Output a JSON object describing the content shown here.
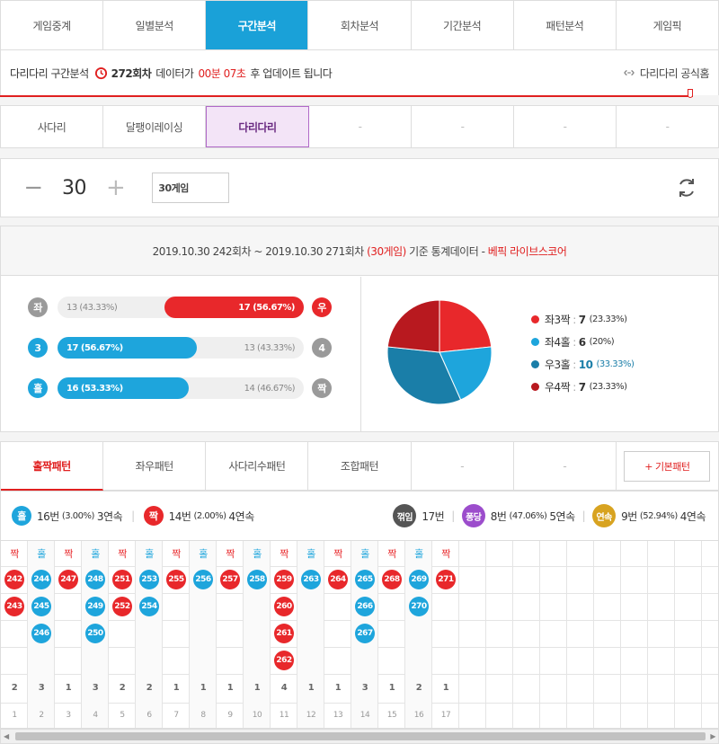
{
  "nav": {
    "tabs": [
      "게임중계",
      "일별분석",
      "구간분석",
      "회차분석",
      "기간분석",
      "패턴분석",
      "게임픽"
    ]
  },
  "info": {
    "game": "다리다리 구간분석",
    "round": "272회차",
    "mid": "데이터가",
    "time": "00분 07초",
    "tail": "후 업데이트 됩니다",
    "official": "다리다리 공식홈"
  },
  "subtabs": [
    "사다리",
    "달팽이레이싱",
    "다리다리",
    "-",
    "-",
    "-",
    "-"
  ],
  "control": {
    "minus": "−",
    "count": "30",
    "plus": "+",
    "games_value": "30게임"
  },
  "stats": {
    "period": "2019.10.30 242회차 ~ 2019.10.30 271회차",
    "games": "(30게임)",
    "basis": "기준 통계데이터 -",
    "brand": "베픽 라이브스코어",
    "rows": [
      {
        "left_icon": "좌",
        "right_icon": "우",
        "left_text": "13 (43.33%)",
        "right_text": "17 (56.67%)",
        "left_pct": 43.33,
        "winner": "right"
      },
      {
        "left_icon": "3",
        "right_icon": "4",
        "left_text": "17 (56.67%)",
        "right_text": "13 (43.33%)",
        "left_pct": 56.67,
        "winner": "left"
      },
      {
        "left_icon": "홀",
        "right_icon": "짝",
        "left_text": "16 (53.33%)",
        "right_text": "14 (46.67%)",
        "left_pct": 53.33,
        "winner": "left"
      }
    ],
    "pie": [
      {
        "label": "좌3짝",
        "count": "7",
        "pct": "(23.33%)",
        "value": 7,
        "color": "#e8282b"
      },
      {
        "label": "좌4홀",
        "count": "6",
        "pct": "(20%)",
        "value": 6,
        "color": "#1ea5dc"
      },
      {
        "label": "우3홀",
        "count": "10",
        "pct": "(33.33%)",
        "value": 10,
        "color": "#1a7ea8"
      },
      {
        "label": "우4짝",
        "count": "7",
        "pct": "(23.33%)",
        "value": 7,
        "color": "#b8191f"
      }
    ]
  },
  "pattern_tabs": [
    "홀짝패턴",
    "좌우패턴",
    "사다리수패턴",
    "조합패턴",
    "-",
    "-"
  ],
  "basic_pattern": "+ 기본패턴",
  "summary": {
    "odd_icon": "홀",
    "odd_count": "16번",
    "odd_pct": "(3.00%)",
    "odd_streak": "3연속",
    "even_icon": "짝",
    "even_count": "14번",
    "even_pct": "(2.00%)",
    "even_streak": "4연속",
    "bend_icon": "꺾임",
    "bend_count": "17번",
    "bounce_icon": "퐁당",
    "bounce_count": "8번",
    "bounce_pct": "(47.06%)",
    "bounce_streak": "5연속",
    "cont_icon": "연속",
    "cont_count": "9번",
    "cont_pct": "(52.94%)",
    "cont_streak": "4연속"
  },
  "columns": [
    {
      "head": "짝",
      "type": "even",
      "balls": [
        "242",
        "243"
      ],
      "count": "2",
      "index": "1"
    },
    {
      "head": "홀",
      "type": "odd",
      "balls": [
        "244",
        "245",
        "246"
      ],
      "count": "3",
      "index": "2"
    },
    {
      "head": "짝",
      "type": "even",
      "balls": [
        "247"
      ],
      "count": "1",
      "index": "3"
    },
    {
      "head": "홀",
      "type": "odd",
      "balls": [
        "248",
        "249",
        "250"
      ],
      "count": "3",
      "index": "4"
    },
    {
      "head": "짝",
      "type": "even",
      "balls": [
        "251",
        "252"
      ],
      "count": "2",
      "index": "5"
    },
    {
      "head": "홀",
      "type": "odd",
      "balls": [
        "253",
        "254"
      ],
      "count": "2",
      "index": "6"
    },
    {
      "head": "짝",
      "type": "even",
      "balls": [
        "255"
      ],
      "count": "1",
      "index": "7"
    },
    {
      "head": "홀",
      "type": "odd",
      "balls": [
        "256"
      ],
      "count": "1",
      "index": "8"
    },
    {
      "head": "짝",
      "type": "even",
      "balls": [
        "257"
      ],
      "count": "1",
      "index": "9"
    },
    {
      "head": "홀",
      "type": "odd",
      "balls": [
        "258"
      ],
      "count": "1",
      "index": "10"
    },
    {
      "head": "짝",
      "type": "even",
      "balls": [
        "259",
        "260",
        "261",
        "262"
      ],
      "count": "4",
      "index": "11"
    },
    {
      "head": "홀",
      "type": "odd",
      "balls": [
        "263"
      ],
      "count": "1",
      "index": "12"
    },
    {
      "head": "짝",
      "type": "even",
      "balls": [
        "264"
      ],
      "count": "1",
      "index": "13"
    },
    {
      "head": "홀",
      "type": "odd",
      "balls": [
        "265",
        "266",
        "267"
      ],
      "count": "3",
      "index": "14"
    },
    {
      "head": "짝",
      "type": "even",
      "balls": [
        "268"
      ],
      "count": "1",
      "index": "15"
    },
    {
      "head": "홀",
      "type": "odd",
      "balls": [
        "269",
        "270"
      ],
      "count": "2",
      "index": "16"
    },
    {
      "head": "짝",
      "type": "even",
      "balls": [
        "271"
      ],
      "count": "1",
      "index": "17"
    }
  ],
  "colors": {
    "red": "#e8282b",
    "blue": "#1ea5dc",
    "accent": "#1aa1d8"
  }
}
